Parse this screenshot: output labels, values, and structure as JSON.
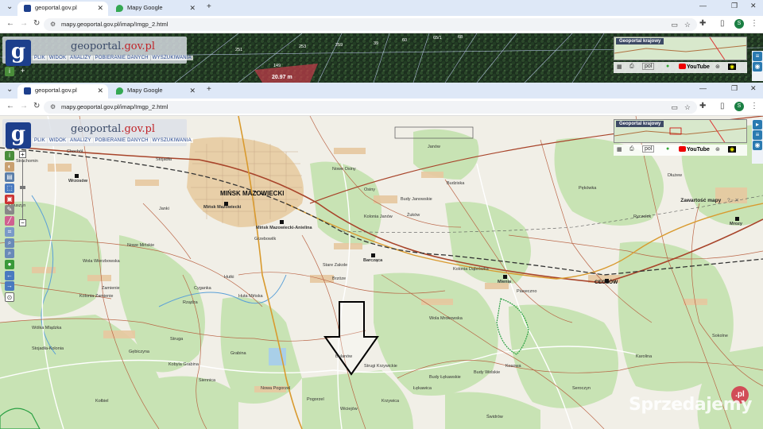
{
  "tabs": [
    {
      "title": "geoportal.gov.pl",
      "active": true
    },
    {
      "title": "Mapy Google",
      "active": false
    }
  ],
  "new_tab_label": "+",
  "url": "mapy.geoportal.gov.pl/imap/Imgp_2.html",
  "logo": {
    "letter": "g",
    "text_a": "geoportal",
    "text_b": ".gov.pl"
  },
  "menu": [
    "PLIK",
    "WIDOK",
    "ANALIZY",
    "POBIERANIE DANYCH",
    "WYSZUKIWANIA"
  ],
  "overview_label": "Geoportal krajowy",
  "lang": "pol",
  "youtube": "YouTube",
  "zawartosc": "Zawartość mapy",
  "top_map": {
    "parcel_numbers": [
      "251",
      "253",
      "259",
      "39",
      "60",
      "65/1",
      "68",
      "149"
    ],
    "measure": "20.97 m"
  },
  "places": [
    "MIŃSK MAZOWIECKI",
    "Mińsk Mazowiecki",
    "Mińsk Mazowiecki-Anielina",
    "Barcząca",
    "Mienia",
    "CEGŁÓW",
    "Mrozy",
    "Wrzosów",
    "Chochół",
    "Strachomin",
    "Stojadła",
    "Nowe Osiny",
    "Osiny",
    "Budy Janowskie",
    "Kolonia Janów",
    "Janów",
    "Żuków",
    "Stare Zakole",
    "Brzóze",
    "Hutki",
    "Huta Mińska",
    "Grabina",
    "Nowa Pogorzel",
    "Pogorzel",
    "Wola Mrokowska",
    "Budy Łękawskie",
    "Łękawica",
    "Krzywica",
    "Wiciejów",
    "Piaseczno",
    "Sokolne",
    "Pękówka",
    "Budziska",
    "Ryczołek",
    "Zamienie",
    "Kolonia Zamienie",
    "Wólka Mlądzka",
    "Gębiczyna",
    "Kobyla Grabina",
    "Rządza",
    "Struga",
    "Bulanów",
    "Kolonia Dąbrówka",
    "Cyganka",
    "Janki",
    "Kałuszyn",
    "Wola Wierzbowska",
    "Strugi Krzywickie",
    "Kosowa",
    "Budy Wolskie",
    "Świdrów",
    "Stojadła-Kolonia",
    "Karolina",
    "Nowe Mińskie",
    "Grzebowilk",
    "Dłużew",
    "Seroczyn",
    "Siennica",
    "Kołbiel"
  ],
  "watermark": "Sprzedajemy",
  "watermark_pl": ".pl",
  "colors": {
    "tabbar": "#dee8f7",
    "logo_blue": "#1d3f8c",
    "logo_red": "#c02328",
    "road_brown": "#a8442a",
    "road_orange": "#d99a2e",
    "rail": "#333333",
    "forest": "#c8e3b4",
    "field": "#f1efe7"
  }
}
